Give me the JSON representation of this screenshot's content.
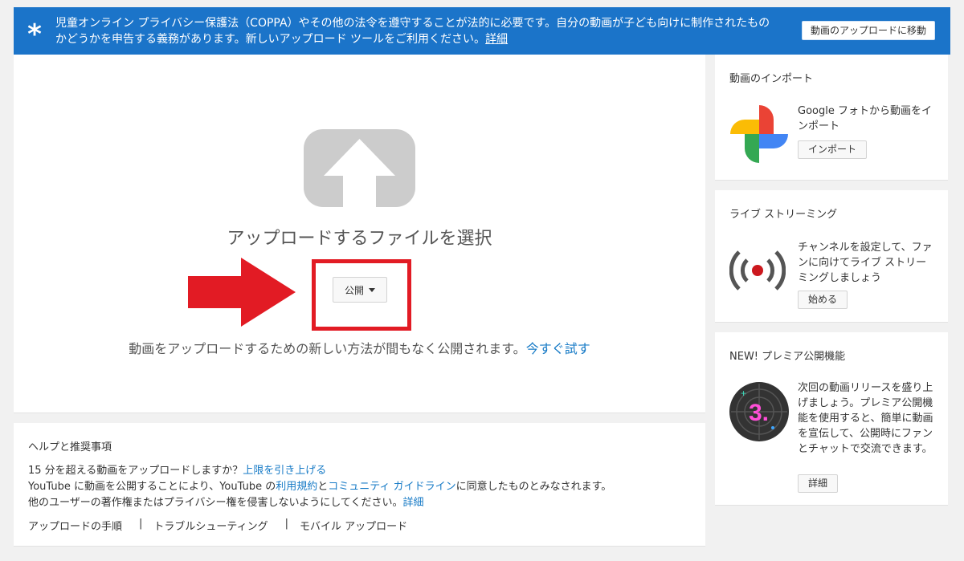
{
  "banner": {
    "star": "*",
    "message": "児童オンライン プライバシー保護法（COPPA）やその他の法令を遵守することが法的に必要です。自分の動画が子ども向けに制作されたものかどうかを申告する義務があります。新しいアップロード ツールをご利用ください。",
    "details_link": "詳細",
    "goto_button": "動画のアップロードに移動"
  },
  "upload": {
    "title": "アップロードするファイルを選択",
    "privacy_label": "公開",
    "notice_text": "動画をアップロードするための新しい方法が間もなく公開されます。",
    "try_now_link": "今すぐ試す"
  },
  "help": {
    "title": "ヘルプと推奨事項",
    "line1_text": "15 分を超える動画をアップロードしますか？",
    "line1_link": "上限を引き上げる",
    "line2_a": "YouTube に動画を公開することにより、YouTube の",
    "line2_link1": "利用規約",
    "line2_b": "と",
    "line2_link2": "コミュニティ ガイドライン",
    "line2_c": "に同意したものとみなされます。",
    "line3_text": "他のユーザーの著作権またはプライバシー権を侵害しないようにしてください。",
    "line3_link": "詳細",
    "links": [
      "アップロードの手順",
      "トラブルシューティング",
      "モバイル アップロード"
    ],
    "separator": "|"
  },
  "side": {
    "import": {
      "title": "動画のインポート",
      "desc": "Google フォトから動画をインポート",
      "button": "インポート",
      "icon": "google-photos-icon"
    },
    "live": {
      "title": "ライブ ストリーミング",
      "desc": "チャンネルを設定して、ファンに向けてライブ ストリーミングしましょう",
      "button": "始める",
      "icon": "live-broadcast-icon"
    },
    "premiere": {
      "title": "NEW! プレミア公開機能",
      "desc": "次回の動画リリースを盛り上げましょう。プレミア公開機能を使用すると、簡単に動画を宣伝して、公開時にファンとチャットで交流できます。",
      "button": "詳細",
      "icon": "premiere-countdown-icon",
      "countdown": "3."
    }
  },
  "colors": {
    "banner_bg": "#1b74c9",
    "link": "#167ac6",
    "highlight_red": "#e21b24"
  }
}
